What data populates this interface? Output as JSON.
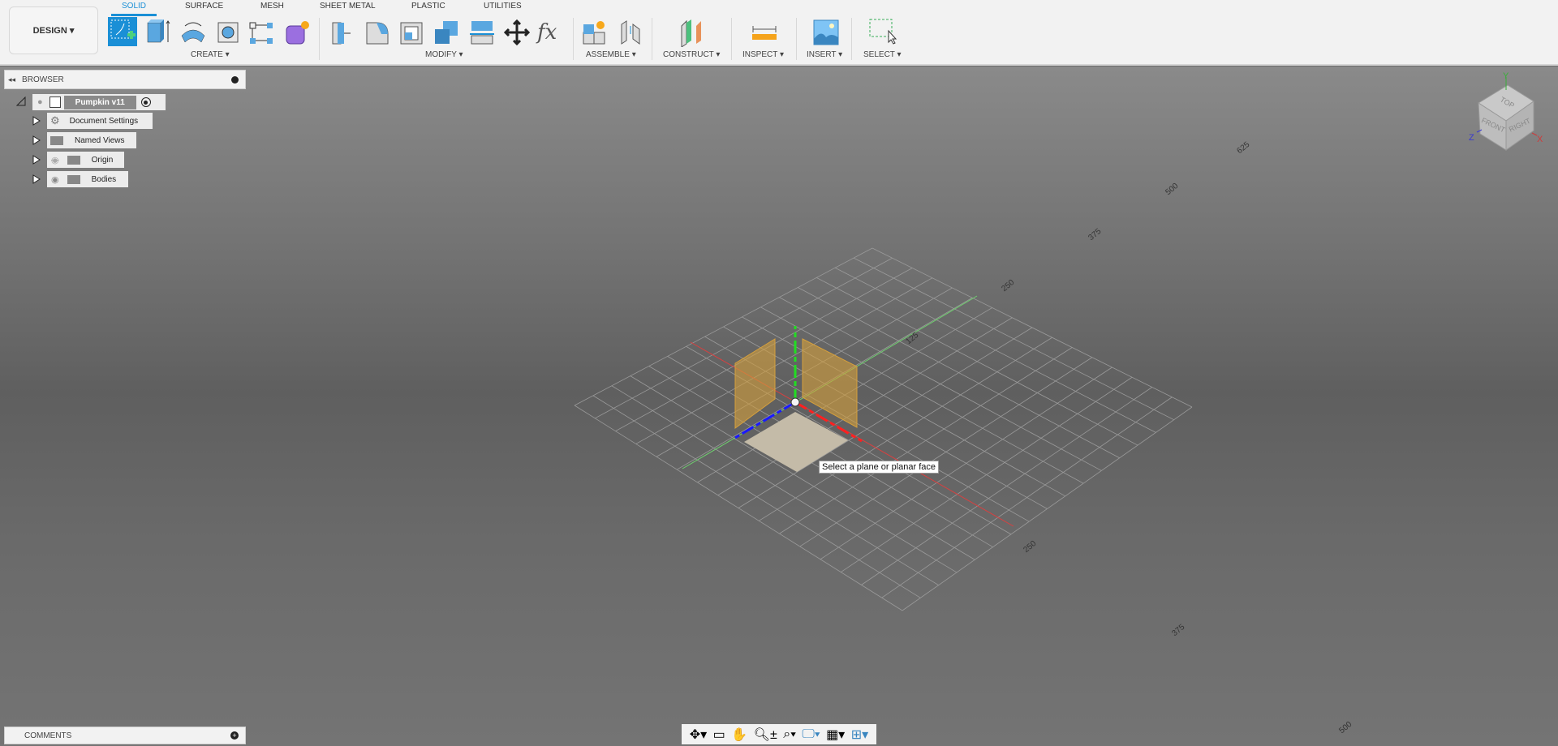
{
  "toolbar": {
    "workspace_label": "DESIGN",
    "tabs": [
      {
        "label": "SOLID",
        "active": true
      },
      {
        "label": "SURFACE"
      },
      {
        "label": "MESH"
      },
      {
        "label": "SHEET METAL"
      },
      {
        "label": "PLASTIC"
      },
      {
        "label": "UTILITIES"
      }
    ],
    "groups": {
      "create": "CREATE",
      "modify": "MODIFY",
      "assemble": "ASSEMBLE",
      "construct": "CONSTRUCT",
      "inspect": "INSPECT",
      "insert": "INSERT",
      "select": "SELECT"
    },
    "fx_label": "fx",
    "accent_color": "#1a8fd6"
  },
  "browser": {
    "title": "BROWSER",
    "root": "Pumpkin v11",
    "items": [
      {
        "label": "Document Settings",
        "icon": "gear-icon"
      },
      {
        "label": "Named Views",
        "icon": "folder-icon"
      },
      {
        "label": "Origin",
        "icon": "folder-icon",
        "visibility": "hidden"
      },
      {
        "label": "Bodies",
        "icon": "folder-icon",
        "visibility": "visible"
      }
    ]
  },
  "viewport": {
    "tooltip": "Select a plane or planar face",
    "green_axis_labels": [
      "125",
      "250",
      "375",
      "500",
      "625"
    ],
    "red_axis_labels": [
      "250",
      "375",
      "500"
    ],
    "viewcube": {
      "top": "TOP",
      "front": "FRONT",
      "right": "RIGHT",
      "x": "X",
      "y": "Y",
      "z": "Z"
    }
  },
  "comments": {
    "title": "COMMENTS"
  }
}
